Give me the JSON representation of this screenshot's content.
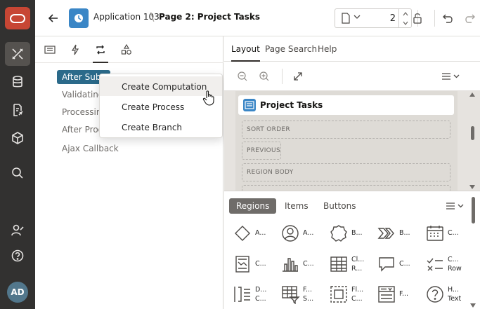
{
  "nav": {
    "avatar": "AD",
    "items": [
      "tools-icon",
      "database-icon",
      "document-edit-icon",
      "package-icon",
      "search-icon",
      "user-settings-icon",
      "help-icon"
    ]
  },
  "header": {
    "app_name": "Application 103",
    "separator": "\\",
    "page_name": "Page 2: Project Tasks",
    "page_number": "2"
  },
  "left": {
    "tree": {
      "selected": "After Submit",
      "items": [
        "Validating",
        "Processing",
        "After Processing",
        "Ajax Callback"
      ]
    },
    "menu": {
      "items": [
        "Create Computation",
        "Create Process",
        "Create Branch"
      ]
    }
  },
  "right": {
    "tabs": [
      "Layout",
      "Page Search",
      "Help"
    ],
    "region_title": "Project Tasks",
    "zones": [
      "SORT ORDER",
      "PREVIOUS",
      "REGION BODY"
    ],
    "gallery_tabs": [
      "Regions",
      "Items",
      "Buttons"
    ],
    "gallery": [
      {
        "l1": "A..."
      },
      {
        "l1": "A..."
      },
      {
        "l1": "B..."
      },
      {
        "l1": "B..."
      },
      {
        "l1": "C..."
      },
      {
        "l1": "C..."
      },
      {
        "l1": "C..."
      },
      {
        "l1": "Cl...",
        "l2": "R..."
      },
      {
        "l1": "C..."
      },
      {
        "l1": "C...",
        "l2": "Row"
      },
      {
        "l1": "D...",
        "l2": "C..."
      },
      {
        "l1": "F...",
        "l2": "S..."
      },
      {
        "l1": "Fl...",
        "l2": "C..."
      },
      {
        "l1": "F..."
      },
      {
        "l1": "H...",
        "l2": "Text"
      }
    ]
  },
  "colors": {
    "nav_bg": "#323130",
    "logo": "#c74634",
    "selected": "#2b6a8a",
    "app_icon": "#3a86c6"
  }
}
